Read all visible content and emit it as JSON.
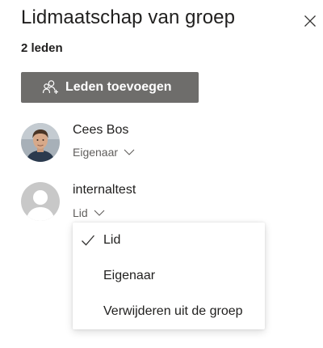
{
  "panel": {
    "title": "Lidmaatschap van groep",
    "member_count": "2 leden",
    "close_icon": "close-icon"
  },
  "add_button": {
    "label": "Leden toevoegen",
    "icon": "add-people-icon",
    "background": "#6e6d6b"
  },
  "members": [
    {
      "name": "Cees Bos",
      "role": "Eigenaar",
      "avatar": "photo"
    },
    {
      "name": "internaltest",
      "role": "Lid",
      "avatar": "placeholder"
    }
  ],
  "role_menu": {
    "items": [
      {
        "label": "Lid",
        "checked": true
      },
      {
        "label": "Eigenaar",
        "checked": false
      },
      {
        "label": "Verwijderen uit de groep",
        "checked": false
      }
    ]
  }
}
